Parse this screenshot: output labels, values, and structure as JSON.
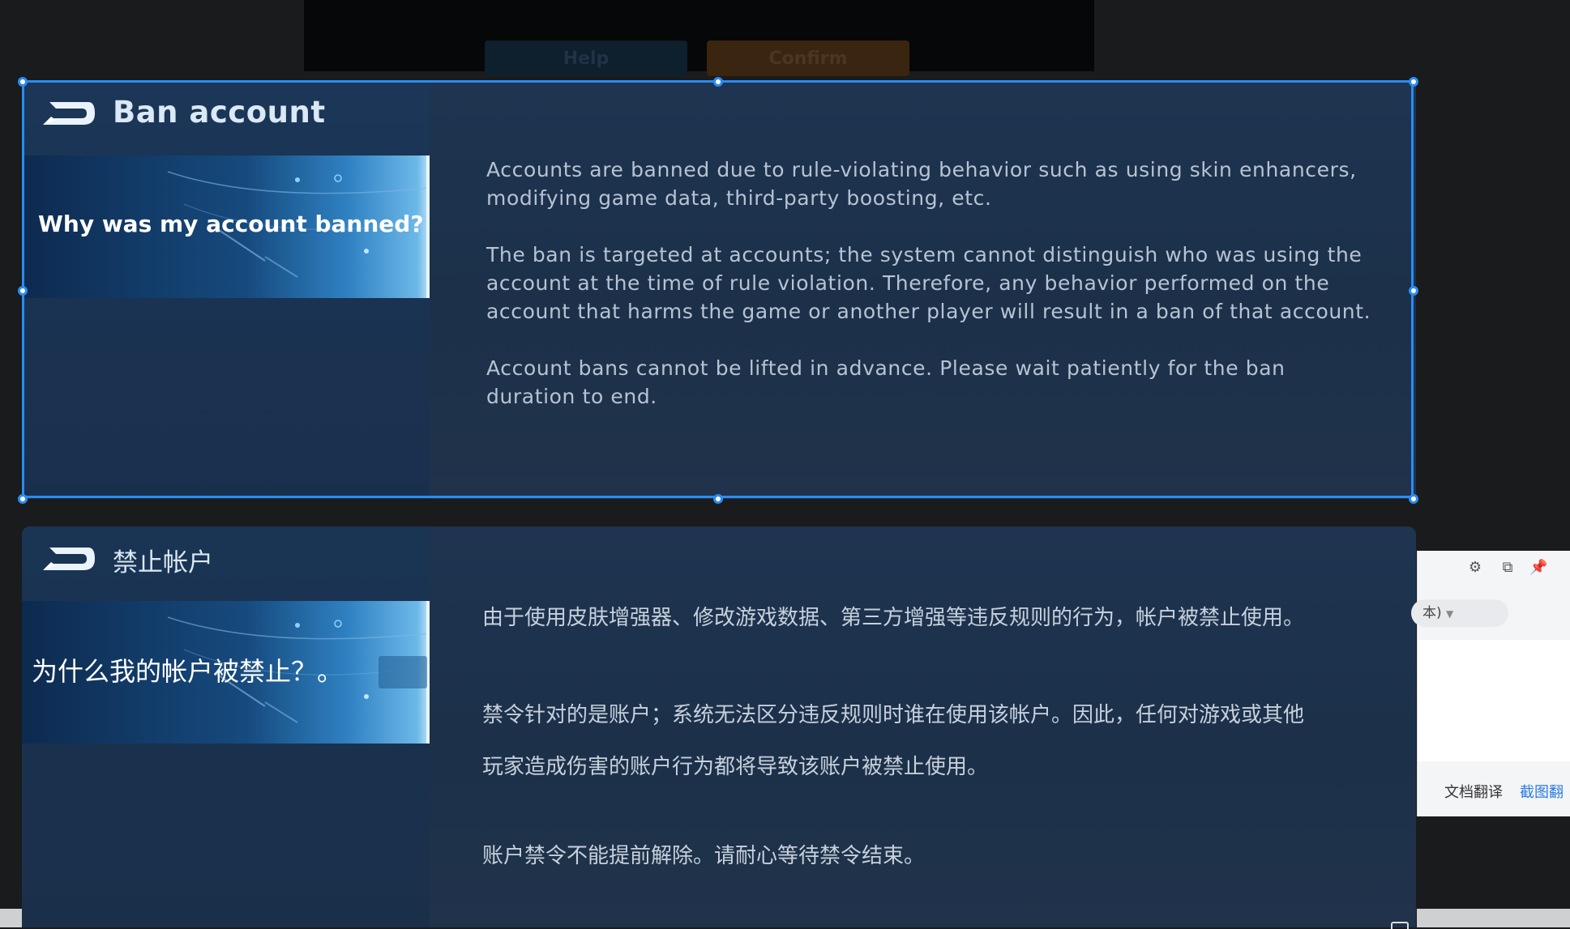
{
  "background_buttons": {
    "help_label": "Help",
    "confirm_label": "Confirm"
  },
  "card_en": {
    "title": "Ban account",
    "question": "Why was my account banned?",
    "paragraphs": [
      "Accounts are banned due to rule-violating behavior such as using skin enhancers, modifying game data, third-party boosting, etc.",
      "The ban is targeted at accounts; the system cannot distinguish who was using the account at the time of rule violation. Therefore, any behavior performed on the account that harms the game or another player will result in a ban of that account.",
      "Account bans cannot be lifted in advance. Please wait patiently for the ban duration to end."
    ]
  },
  "card_zh": {
    "title": "禁止帐户",
    "question": "为什么我的帐户被禁止？。",
    "paragraphs": [
      "由于使用皮肤增强器、修改游戏数据、第三方增强等违反规则的行为，帐户被禁止使用。",
      "禁令针对的是账户；系统无法区分违反规则时谁在使用该帐户。因此，任何对游戏或其他",
      "玩家造成伤害的账户行为都将导致该账户被禁止使用。",
      "账户禁令不能提前解除。请耐心等待禁令结束。"
    ]
  },
  "translator_panel": {
    "icons": [
      "gear-icon",
      "crop-icon",
      "pin-icon"
    ],
    "language_select": "本)",
    "doc_translate_label": "文档翻译",
    "screenshot_translate_label": "截图翻"
  },
  "colors": {
    "selection": "#2a8cf2",
    "card_bg": "#1c3049",
    "link_blue": "#2a7ae2"
  }
}
